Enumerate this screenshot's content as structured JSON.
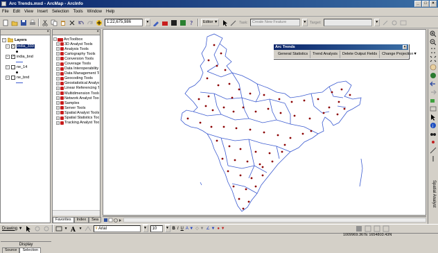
{
  "window": {
    "title": "Arc Trends.mxd - ArcMap - ArcInfo"
  },
  "menu": [
    "File",
    "Edit",
    "View",
    "Insert",
    "Selection",
    "Tools",
    "Window",
    "Help"
  ],
  "toolbar": {
    "scale": "1:22,675,986",
    "editor_label": "Editor",
    "task_label": "Task:",
    "task_value": "Create New Feature",
    "target_label": "Target:",
    "target_value": ""
  },
  "toc": {
    "root": "Layers",
    "layers": [
      {
        "name": "india_333",
        "checked": true,
        "selected": true,
        "symbol": "point"
      },
      {
        "name": "india_bnd",
        "checked": true,
        "selected": false,
        "symbol": "line"
      },
      {
        "name": "ne_14",
        "checked": false,
        "selected": false,
        "symbol": "point"
      },
      {
        "name": "ne_bnd",
        "checked": false,
        "selected": false,
        "symbol": "line"
      }
    ],
    "display_label": "Display",
    "tabs": [
      "Source",
      "Selection"
    ]
  },
  "toolbox": {
    "root": "ArcToolbox",
    "items": [
      "3D Analyst Tools",
      "Analysis Tools",
      "Cartography Tools",
      "Conversion Tools",
      "Coverage Tools",
      "Data Interoperability",
      "Data Management Too",
      "Geocoding Tools",
      "Geostatistical Analyst",
      "Linear Referencing To",
      "Multidimension Tools",
      "Network Analyst Tools",
      "Samples",
      "Server Tools",
      "Spatial Analyst Tools",
      "Spatial Statistics Tools",
      "Tracking Analyst Tools"
    ],
    "tabs": [
      "Favorites",
      "Index",
      "Sea"
    ]
  },
  "arc_trends": {
    "title": "Arc Trends",
    "buttons": [
      "General Statistics",
      "Trend Analysis",
      "Delete Output Fields",
      "Change Projection"
    ]
  },
  "drawing": {
    "label": "Drawing",
    "font": "Arial",
    "size": "10",
    "bold": "B",
    "italic": "I",
    "underline": "U"
  },
  "right_tools": {
    "vertical_label": "Spatial Analyst"
  },
  "status": {
    "coordinates": "1009969.367E  1654803.43N"
  },
  "colors": {
    "title_bar": "#0a246a",
    "boundary": "#3a5ad0",
    "point": "#8b0000",
    "toolbox_icon": "#c81e1e"
  }
}
